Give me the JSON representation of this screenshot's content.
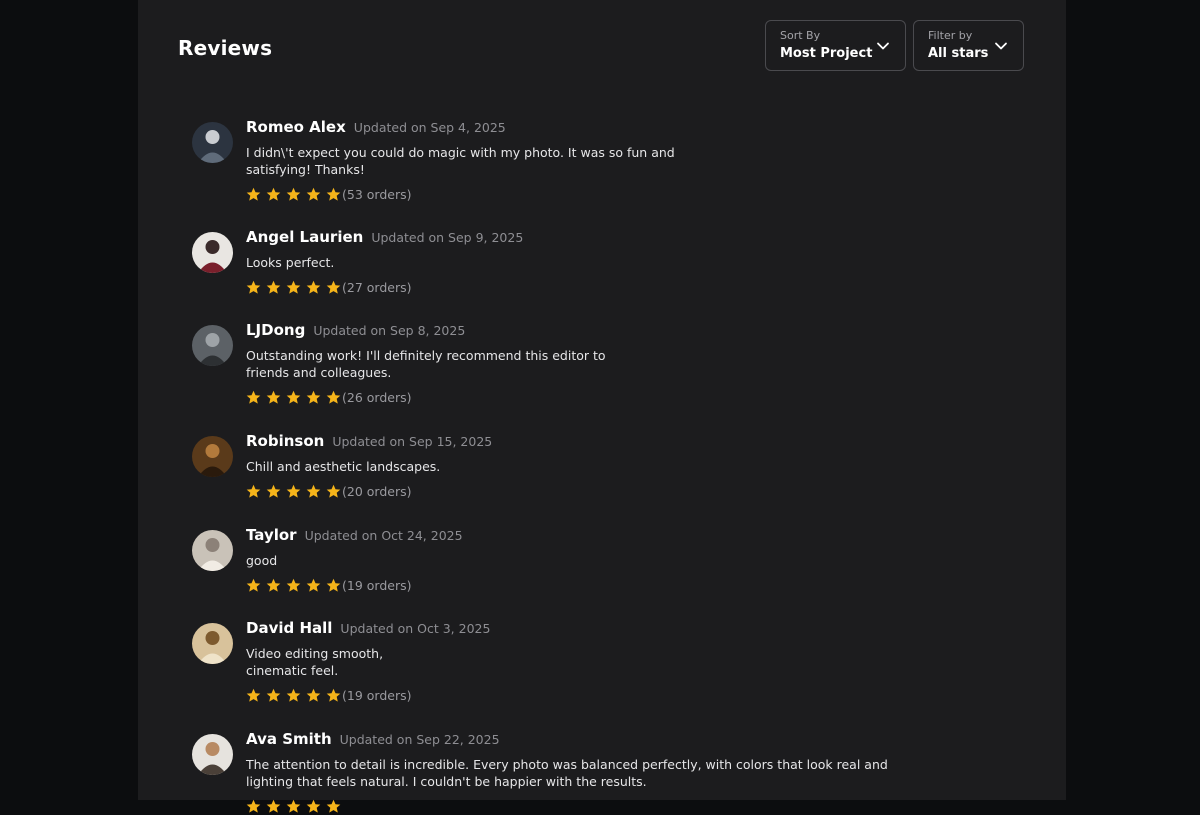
{
  "page": {
    "title": "Reviews"
  },
  "sort": {
    "label": "Sort By",
    "value": "Most Project"
  },
  "filter": {
    "label": "Filter by",
    "value": "All stars"
  },
  "star_color": "#f5b41a",
  "reviews": [
    {
      "name": "Romeo Alex",
      "updated": "Updated on Sep 4, 2025",
      "text_lines": [
        "I didn\\'t expect you could do magic with my photo. It was so fun and",
        "satisfying! Thanks!"
      ],
      "rating": 5,
      "orders": "(53 orders)",
      "avatar": "photo-person-icon"
    },
    {
      "name": "Angel Laurien",
      "updated": "Updated on Sep 9, 2025",
      "text_lines": [
        "Looks perfect."
      ],
      "rating": 5,
      "orders": "(27 orders)",
      "avatar": "photo-woman-icon"
    },
    {
      "name": "LJDong",
      "updated": "Updated on Sep 8, 2025",
      "text_lines": [
        "Outstanding work! I'll definitely recommend this editor to",
        "friends and colleagues."
      ],
      "rating": 5,
      "orders": "(26 orders)",
      "avatar": "photo-landscape-icon"
    },
    {
      "name": "Robinson",
      "updated": "Updated on Sep 15, 2025",
      "text_lines": [
        "Chill and aesthetic landscapes."
      ],
      "rating": 5,
      "orders": "(20 orders)",
      "avatar": "photo-warm-icon"
    },
    {
      "name": "Taylor",
      "updated": "Updated on Oct 24, 2025",
      "text_lines": [
        "good"
      ],
      "rating": 5,
      "orders": "(19 orders)",
      "avatar": "photo-room-icon"
    },
    {
      "name": "David Hall",
      "updated": "Updated on Oct 3, 2025",
      "text_lines": [
        "Video editing smooth,",
        "cinematic feel."
      ],
      "rating": 5,
      "orders": "(19 orders)",
      "avatar": "photo-cream-icon"
    },
    {
      "name": "Ava Smith",
      "updated": "Updated on Sep 22, 2025",
      "text_lines": [
        "The attention to detail is incredible. Every photo was balanced perfectly, with colors that look real and",
        "lighting that feels natural. I couldn't be happier with the results."
      ],
      "rating": 5,
      "orders": "",
      "avatar": "photo-beach-icon"
    }
  ]
}
